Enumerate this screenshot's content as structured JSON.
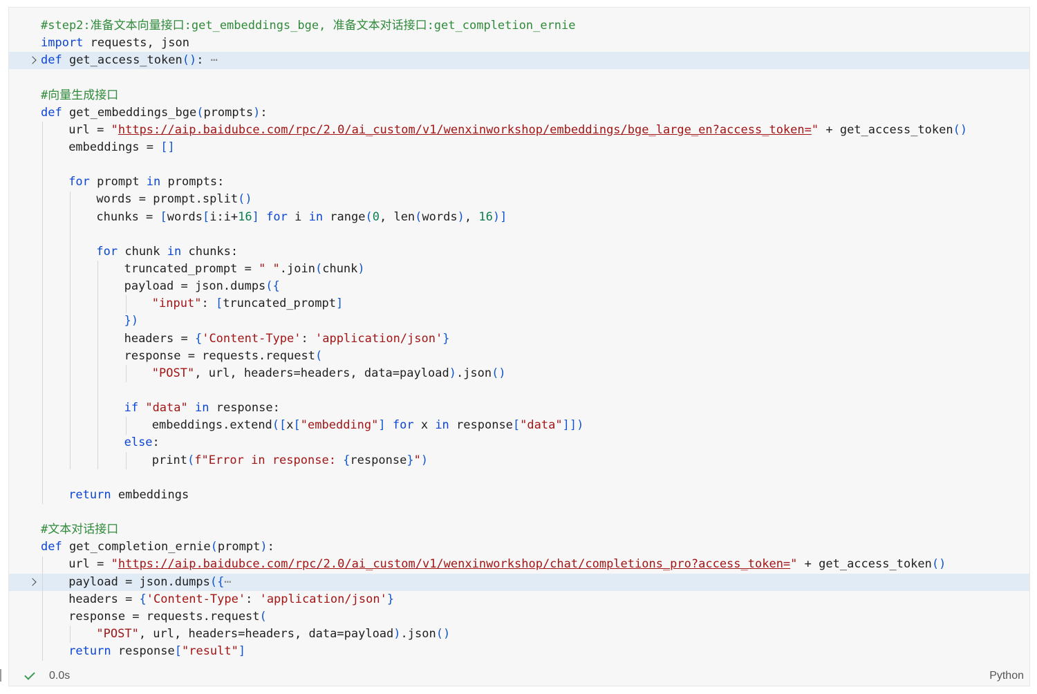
{
  "cell": {
    "lines": [
      {
        "indent": 0,
        "hl": false,
        "fold": false,
        "tokens": [
          [
            "cm",
            "#step2:准备文本向量接口:get_embeddings_bge, 准备文本对话接口:get_completion_ernie"
          ]
        ]
      },
      {
        "indent": 0,
        "hl": false,
        "fold": false,
        "tokens": [
          [
            "kw",
            "import"
          ],
          [
            "fn",
            " requests, json"
          ]
        ]
      },
      {
        "indent": 0,
        "hl": true,
        "fold": true,
        "tokens": [
          [
            "kw",
            "def"
          ],
          [
            "fn",
            " get_access_token"
          ],
          [
            "pr",
            "()"
          ],
          [
            "fn",
            ":"
          ],
          [
            "ellip",
            " ⋯"
          ]
        ]
      },
      {
        "indent": 0,
        "hl": false,
        "fold": false,
        "tokens": []
      },
      {
        "indent": 0,
        "hl": false,
        "fold": false,
        "tokens": [
          [
            "cm",
            "#向量生成接口"
          ]
        ]
      },
      {
        "indent": 0,
        "hl": false,
        "fold": false,
        "tokens": [
          [
            "kw",
            "def"
          ],
          [
            "fn",
            " get_embeddings_bge"
          ],
          [
            "pr",
            "("
          ],
          [
            "fn",
            "prompts"
          ],
          [
            "pr",
            ")"
          ],
          [
            "fn",
            ":"
          ]
        ]
      },
      {
        "indent": 1,
        "hl": false,
        "fold": false,
        "tokens": [
          [
            "fn",
            "url = "
          ],
          [
            "str",
            "\""
          ],
          [
            "url",
            "https://aip.baidubce.com/rpc/2.0/ai_custom/v1/wenxinworkshop/embeddings/bge_large_en?access_token="
          ],
          [
            "str",
            "\""
          ],
          [
            "fn",
            " + get_access_token"
          ],
          [
            "pr",
            "()"
          ]
        ]
      },
      {
        "indent": 1,
        "hl": false,
        "fold": false,
        "tokens": [
          [
            "fn",
            "embeddings = "
          ],
          [
            "pr",
            "[]"
          ]
        ]
      },
      {
        "indent": 0,
        "hl": false,
        "fold": false,
        "tokens": []
      },
      {
        "indent": 1,
        "hl": false,
        "fold": false,
        "tokens": [
          [
            "kw",
            "for"
          ],
          [
            "fn",
            " prompt "
          ],
          [
            "kw",
            "in"
          ],
          [
            "fn",
            " prompts:"
          ]
        ]
      },
      {
        "indent": 2,
        "hl": false,
        "fold": false,
        "tokens": [
          [
            "fn",
            "words = prompt.split"
          ],
          [
            "pr",
            "()"
          ]
        ]
      },
      {
        "indent": 2,
        "hl": false,
        "fold": false,
        "tokens": [
          [
            "fn",
            "chunks = "
          ],
          [
            "pr",
            "["
          ],
          [
            "fn",
            "words"
          ],
          [
            "pr",
            "["
          ],
          [
            "fn",
            "i:i+"
          ],
          [
            "num",
            "16"
          ],
          [
            "pr",
            "]"
          ],
          [
            "fn",
            " "
          ],
          [
            "kw",
            "for"
          ],
          [
            "fn",
            " i "
          ],
          [
            "kw",
            "in"
          ],
          [
            "fn",
            " range"
          ],
          [
            "pr",
            "("
          ],
          [
            "num",
            "0"
          ],
          [
            "fn",
            ", len"
          ],
          [
            "pr",
            "("
          ],
          [
            "fn",
            "words"
          ],
          [
            "pr",
            ")"
          ],
          [
            "fn",
            ", "
          ],
          [
            "num",
            "16"
          ],
          [
            "pr",
            ")]"
          ]
        ]
      },
      {
        "indent": 0,
        "hl": false,
        "fold": false,
        "tokens": []
      },
      {
        "indent": 2,
        "hl": false,
        "fold": false,
        "tokens": [
          [
            "kw",
            "for"
          ],
          [
            "fn",
            " chunk "
          ],
          [
            "kw",
            "in"
          ],
          [
            "fn",
            " chunks:"
          ]
        ]
      },
      {
        "indent": 3,
        "hl": false,
        "fold": false,
        "tokens": [
          [
            "fn",
            "truncated_prompt = "
          ],
          [
            "str",
            "\" \""
          ],
          [
            "fn",
            ".join"
          ],
          [
            "pr",
            "("
          ],
          [
            "fn",
            "chunk"
          ],
          [
            "pr",
            ")"
          ]
        ]
      },
      {
        "indent": 3,
        "hl": false,
        "fold": false,
        "tokens": [
          [
            "fn",
            "payload = json.dumps"
          ],
          [
            "pr",
            "({"
          ]
        ]
      },
      {
        "indent": 4,
        "hl": false,
        "fold": false,
        "tokens": [
          [
            "str",
            "\"input\""
          ],
          [
            "fn",
            ": "
          ],
          [
            "pr",
            "["
          ],
          [
            "fn",
            "truncated_prompt"
          ],
          [
            "pr",
            "]"
          ]
        ]
      },
      {
        "indent": 3,
        "hl": false,
        "fold": false,
        "tokens": [
          [
            "pr",
            "})"
          ]
        ]
      },
      {
        "indent": 3,
        "hl": false,
        "fold": false,
        "tokens": [
          [
            "fn",
            "headers = "
          ],
          [
            "pr",
            "{"
          ],
          [
            "str",
            "'Content-Type'"
          ],
          [
            "fn",
            ": "
          ],
          [
            "str",
            "'application/json'"
          ],
          [
            "pr",
            "}"
          ]
        ]
      },
      {
        "indent": 3,
        "hl": false,
        "fold": false,
        "tokens": [
          [
            "fn",
            "response = requests.request"
          ],
          [
            "pr",
            "("
          ]
        ]
      },
      {
        "indent": 4,
        "hl": false,
        "fold": false,
        "tokens": [
          [
            "str",
            "\"POST\""
          ],
          [
            "fn",
            ", url, headers=headers, data=payload"
          ],
          [
            "pr",
            ")"
          ],
          [
            "fn",
            ".json"
          ],
          [
            "pr",
            "()"
          ]
        ]
      },
      {
        "indent": 0,
        "hl": false,
        "fold": false,
        "tokens": []
      },
      {
        "indent": 3,
        "hl": false,
        "fold": false,
        "tokens": [
          [
            "kw",
            "if"
          ],
          [
            "fn",
            " "
          ],
          [
            "str",
            "\"data\""
          ],
          [
            "fn",
            " "
          ],
          [
            "kw",
            "in"
          ],
          [
            "fn",
            " response:"
          ]
        ]
      },
      {
        "indent": 4,
        "hl": false,
        "fold": false,
        "tokens": [
          [
            "fn",
            "embeddings.extend"
          ],
          [
            "pr",
            "(["
          ],
          [
            "fn",
            "x"
          ],
          [
            "pr",
            "["
          ],
          [
            "str",
            "\"embedding\""
          ],
          [
            "pr",
            "]"
          ],
          [
            "fn",
            " "
          ],
          [
            "kw",
            "for"
          ],
          [
            "fn",
            " x "
          ],
          [
            "kw",
            "in"
          ],
          [
            "fn",
            " response"
          ],
          [
            "pr",
            "["
          ],
          [
            "str",
            "\"data\""
          ],
          [
            "pr",
            "]])"
          ]
        ]
      },
      {
        "indent": 3,
        "hl": false,
        "fold": false,
        "tokens": [
          [
            "kw",
            "else"
          ],
          [
            "fn",
            ":"
          ]
        ]
      },
      {
        "indent": 4,
        "hl": false,
        "fold": false,
        "tokens": [
          [
            "fn",
            "print"
          ],
          [
            "pr",
            "("
          ],
          [
            "str",
            "f\"Error in response: "
          ],
          [
            "pr",
            "{"
          ],
          [
            "fn",
            "response"
          ],
          [
            "pr",
            "}"
          ],
          [
            "str",
            "\""
          ],
          [
            "pr",
            ")"
          ]
        ]
      },
      {
        "indent": 0,
        "hl": false,
        "fold": false,
        "tokens": []
      },
      {
        "indent": 1,
        "hl": false,
        "fold": false,
        "tokens": [
          [
            "kw",
            "return"
          ],
          [
            "fn",
            " embeddings"
          ]
        ]
      },
      {
        "indent": 0,
        "hl": false,
        "fold": false,
        "tokens": []
      },
      {
        "indent": 0,
        "hl": false,
        "fold": false,
        "tokens": [
          [
            "cm",
            "#文本对话接口"
          ]
        ]
      },
      {
        "indent": 0,
        "hl": false,
        "fold": false,
        "tokens": [
          [
            "kw",
            "def"
          ],
          [
            "fn",
            " get_completion_ernie"
          ],
          [
            "pr",
            "("
          ],
          [
            "fn",
            "prompt"
          ],
          [
            "pr",
            ")"
          ],
          [
            "fn",
            ":"
          ]
        ]
      },
      {
        "indent": 1,
        "hl": false,
        "fold": false,
        "tokens": [
          [
            "fn",
            "url = "
          ],
          [
            "str",
            "\""
          ],
          [
            "url",
            "https://aip.baidubce.com/rpc/2.0/ai_custom/v1/wenxinworkshop/chat/completions_pro?access_token="
          ],
          [
            "str",
            "\""
          ],
          [
            "fn",
            " + get_access_token"
          ],
          [
            "pr",
            "()"
          ]
        ]
      },
      {
        "indent": 1,
        "hl": true,
        "fold": true,
        "tokens": [
          [
            "fn",
            "payload = json.dumps"
          ],
          [
            "pr",
            "({"
          ],
          [
            "ellip",
            "⋯"
          ]
        ]
      },
      {
        "indent": 1,
        "hl": false,
        "fold": false,
        "tokens": [
          [
            "fn",
            "headers = "
          ],
          [
            "pr",
            "{"
          ],
          [
            "str",
            "'Content-Type'"
          ],
          [
            "fn",
            ": "
          ],
          [
            "str",
            "'application/json'"
          ],
          [
            "pr",
            "}"
          ]
        ]
      },
      {
        "indent": 1,
        "hl": false,
        "fold": false,
        "tokens": [
          [
            "fn",
            "response = requests.request"
          ],
          [
            "pr",
            "("
          ]
        ]
      },
      {
        "indent": 2,
        "hl": false,
        "fold": false,
        "tokens": [
          [
            "str",
            "\"POST\""
          ],
          [
            "fn",
            ", url, headers=headers, data=payload"
          ],
          [
            "pr",
            ")"
          ],
          [
            "fn",
            ".json"
          ],
          [
            "pr",
            "()"
          ]
        ]
      },
      {
        "indent": 1,
        "hl": false,
        "fold": false,
        "tokens": [
          [
            "kw",
            "return"
          ],
          [
            "fn",
            " response"
          ],
          [
            "pr",
            "["
          ],
          [
            "str",
            "\"result\""
          ],
          [
            "pr",
            "]"
          ]
        ]
      }
    ]
  },
  "status": {
    "time": "0.0s",
    "language": "Python"
  },
  "colors": {
    "keyword": "#0b45d6",
    "comment": "#2f8a3a",
    "string": "#a31515",
    "number": "#0a8051",
    "highlight": "#e1ebf5",
    "success": "#3a9a52"
  },
  "icons": {
    "fold": "chevron-right-icon",
    "status": "check-icon"
  }
}
